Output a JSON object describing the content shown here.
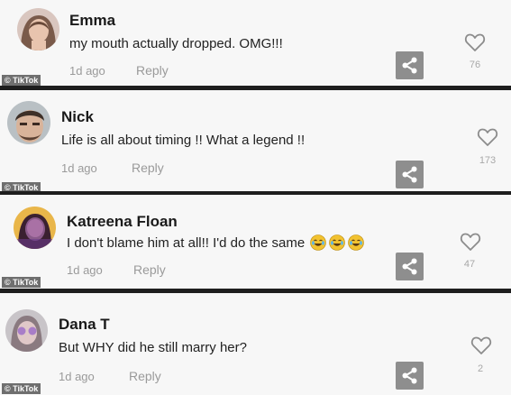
{
  "watermark": "© TikTok",
  "colors": {
    "divider": "#1e1e1e",
    "panel": "#f7f7f7",
    "share_button": "#8e8e8e",
    "muted_text": "#9a9a9a"
  },
  "comments": [
    {
      "username": "Emma",
      "text": "my mouth actually dropped. OMG!!!",
      "time": "1d ago",
      "reply_label": "Reply",
      "likes": "76",
      "like_icon": "heart-outline-icon",
      "share_icon": "share-icon"
    },
    {
      "username": "Nick",
      "text": "Life is all about timing !! What a legend !!",
      "time": "1d ago",
      "reply_label": "Reply",
      "likes": "173",
      "like_icon": "heart-outline-icon",
      "share_icon": "share-icon"
    },
    {
      "username": "Katreena Floan",
      "text": "I don't blame him at all!! I'd do the same",
      "emojis": [
        "laughing-crying-emoji",
        "laughing-crying-emoji",
        "laughing-crying-emoji"
      ],
      "time": "1d ago",
      "reply_label": "Reply",
      "likes": "47",
      "like_icon": "heart-outline-icon",
      "share_icon": "share-icon"
    },
    {
      "username": "Dana T",
      "text": "But WHY did he still marry her?",
      "time": "1d ago",
      "reply_label": "Reply",
      "likes": "2",
      "like_icon": "heart-outline-icon",
      "share_icon": "share-icon"
    }
  ]
}
